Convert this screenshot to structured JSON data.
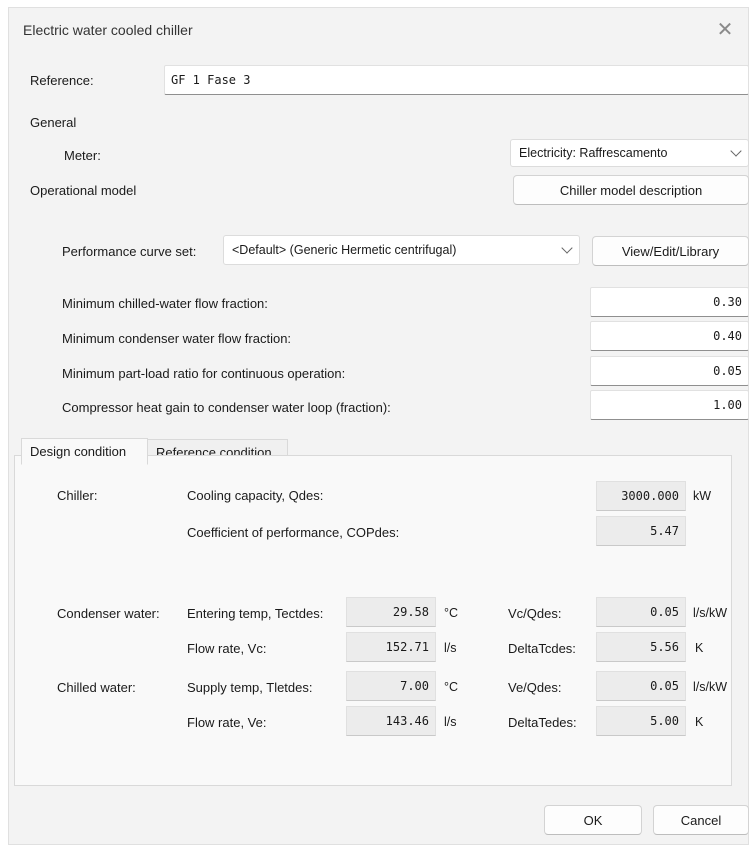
{
  "window": {
    "title": "Electric water cooled chiller",
    "close_glyph": "✕"
  },
  "reference": {
    "label": "Reference:",
    "value": "GF 1 Fase 3"
  },
  "general": {
    "heading": "General",
    "meter_label": "Meter:",
    "meter_value": "Electricity: Raffrescamento"
  },
  "operational": {
    "label": "Operational model",
    "description_button": "Chiller model description",
    "curve_label": "Performance curve set:",
    "curve_value": "<Default> (Generic Hermetic centrifugal)",
    "library_button": "View/Edit/Library",
    "fields": [
      {
        "label": "Minimum chilled-water flow fraction:",
        "value": "0.30"
      },
      {
        "label": "Minimum condenser water flow fraction:",
        "value": "0.40"
      },
      {
        "label": "Minimum part-load ratio for continuous operation:",
        "value": "0.05"
      },
      {
        "label": "Compressor heat gain to condenser water loop (fraction):",
        "value": "1.00"
      }
    ]
  },
  "tabs": [
    "Design condition",
    "Reference condition"
  ],
  "design": {
    "chiller_label": "Chiller:",
    "capacity_label": "Cooling capacity, Qdes:",
    "capacity_value": "3000.000",
    "capacity_unit": "kW",
    "cop_label": "Coefficient of performance, COPdes:",
    "cop_value": "5.47",
    "condenser": {
      "label": "Condenser water:",
      "temp_label": "Entering temp, Tectdes:",
      "temp_value": "29.58",
      "temp_unit": "°C",
      "flow_label": "Flow rate, Vc:",
      "flow_value": "152.71",
      "flow_unit": "l/s",
      "ratio_label": "Vc/Qdes:",
      "ratio_value": "0.05",
      "ratio_unit": "l/s/kW",
      "delta_label": "DeltaTcdes:",
      "delta_value": "5.56",
      "delta_unit": "K"
    },
    "chilled": {
      "label": "Chilled water:",
      "temp_label": "Supply temp, Tletdes:",
      "temp_value": "7.00",
      "temp_unit": "°C",
      "flow_label": "Flow rate, Ve:",
      "flow_value": "143.46",
      "flow_unit": "l/s",
      "ratio_label": "Ve/Qdes:",
      "ratio_value": "0.05",
      "ratio_unit": "l/s/kW",
      "delta_label": "DeltaTedes:",
      "delta_value": "5.00",
      "delta_unit": "K"
    }
  },
  "buttons": {
    "ok": "OK",
    "cancel": "Cancel"
  }
}
